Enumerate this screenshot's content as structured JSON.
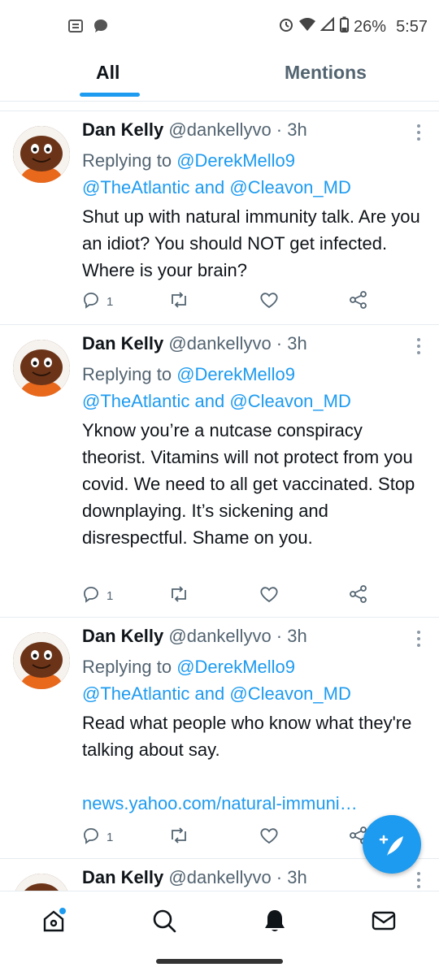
{
  "status_bar": {
    "battery": "26%",
    "time": "5:57"
  },
  "tabs": [
    {
      "label": "All"
    },
    {
      "label": "Mentions"
    }
  ],
  "tweets": [
    {
      "name": "Dan Kelly",
      "handle_time": "@dankellyvo · 3h",
      "replying_prefix": "Replying to",
      "reply_to_1": "@DerekMello9",
      "reply_to_2": "@TheAtlantic",
      "reply_and": "and",
      "reply_to_3": "@Cleavon_MD",
      "text": "Shut up with natural immunity talk. Are you an idiot? You should NOT get infected. Where is your brain?",
      "reply_count": "1"
    },
    {
      "name": "Dan Kelly",
      "handle_time": "@dankellyvo · 3h",
      "replying_prefix": "Replying to",
      "reply_to_1": "@DerekMello9",
      "reply_to_2": "@TheAtlantic",
      "reply_and": "and",
      "reply_to_3": "@Cleavon_MD",
      "text": "Yknow you’re a nutcase conspiracy theorist. Vitamins will not protect from you covid. We need to all get vaccinated. Stop downplaying. It’s sickening and disrespectful. Shame on you.",
      "reply_count": "1"
    },
    {
      "name": "Dan Kelly",
      "handle_time": "@dankellyvo · 3h",
      "replying_prefix": "Replying to",
      "reply_to_1": "@DerekMello9",
      "reply_to_2": "@TheAtlantic",
      "reply_and": "and",
      "reply_to_3": "@Cleavon_MD",
      "text": "Read what people who know what they're talking about say.",
      "link": "news.yahoo.com/natural-immuni…",
      "reply_count": "1"
    },
    {
      "name": "Dan Kelly",
      "handle_time": "@dankellyvo · 3h"
    }
  ],
  "colors": {
    "accent": "#1d9bf0",
    "text": "#0f1419",
    "secondary": "#536471"
  }
}
